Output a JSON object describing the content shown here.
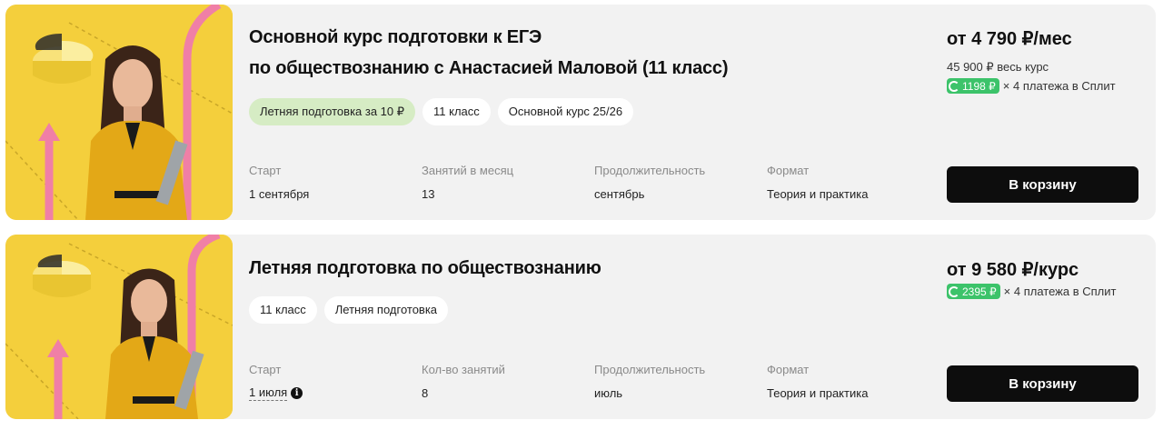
{
  "courses": [
    {
      "title_line1": "Основной курс подготовки к ЕГЭ",
      "title_line2": "по обществознанию с Анастасией Маловой (11 класс)",
      "tags": [
        "Летняя подготовка за 10 ₽",
        "11 класс",
        "Основной курс 25/26"
      ],
      "meta": [
        {
          "label": "Старт",
          "value": "1 сентября"
        },
        {
          "label": "Занятий в месяц",
          "value": "13"
        },
        {
          "label": "Продолжительность",
          "value": "сентябрь"
        },
        {
          "label": "Формат",
          "value": "Теория и практика"
        }
      ],
      "price": "от 4 790 ₽/мес",
      "full_price": "45 900 ₽ весь курс",
      "split_amount": "1198 ₽",
      "split_text": "× 4 платежа в Сплит",
      "button_label": "В корзину"
    },
    {
      "title_line1": "Летняя подготовка по обществознанию",
      "tags": [
        "11 класс",
        "Летняя подготовка"
      ],
      "meta": [
        {
          "label": "Старт",
          "value": "1 июля"
        },
        {
          "label": "Кол-во занятий",
          "value": "8"
        },
        {
          "label": "Продолжительность",
          "value": "июль"
        },
        {
          "label": "Формат",
          "value": "Теория и практика"
        }
      ],
      "price": "от 9 580 ₽/курс",
      "split_amount": "2395 ₽",
      "split_text": "× 4 платежа в Сплит",
      "button_label": "В корзину"
    }
  ],
  "icons": {
    "info": "info-icon",
    "split_logo": "split-logo-icon"
  },
  "colors": {
    "thumbnail_bg": "#f4cf3c",
    "accent_pink": "#f07fa6",
    "split_green": "#3cc36a",
    "tag_green": "#d6ecc4",
    "button_bg": "#0d0d0d",
    "card_bg": "#f2f2f2"
  }
}
